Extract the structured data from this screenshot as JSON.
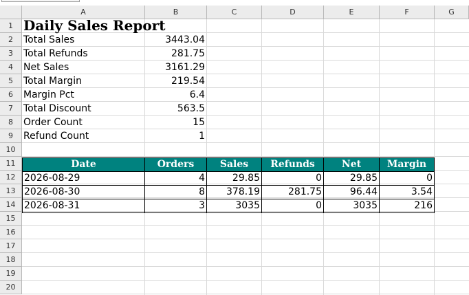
{
  "columns": [
    "A",
    "B",
    "C",
    "D",
    "E",
    "F",
    "G"
  ],
  "rows": [
    "1",
    "2",
    "3",
    "4",
    "5",
    "6",
    "7",
    "8",
    "9",
    "10",
    "11",
    "12",
    "13",
    "14",
    "15",
    "16",
    "17",
    "18",
    "19",
    "20"
  ],
  "title": "Daily Sales Report",
  "summary": [
    {
      "label": "Total Sales",
      "value": "3443.04"
    },
    {
      "label": "Total Refunds",
      "value": "281.75"
    },
    {
      "label": "Net Sales",
      "value": "3161.29"
    },
    {
      "label": "Total Margin",
      "value": "219.54"
    },
    {
      "label": "Margin Pct",
      "value": "6.4"
    },
    {
      "label": "Total Discount",
      "value": "563.5"
    },
    {
      "label": "Order Count",
      "value": "15"
    },
    {
      "label": "Refund Count",
      "value": "1"
    }
  ],
  "table": {
    "headers": [
      "Date",
      "Orders",
      "Sales",
      "Refunds",
      "Net",
      "Margin"
    ],
    "rows": [
      [
        "2026-08-29",
        "4",
        "29.85",
        "0",
        "29.85",
        "0"
      ],
      [
        "2026-08-30",
        "8",
        "378.19",
        "281.75",
        "96.44",
        "3.54"
      ],
      [
        "2026-08-31",
        "3",
        "3035",
        "0",
        "3035",
        "216"
      ]
    ],
    "header_color": "#00827f"
  }
}
